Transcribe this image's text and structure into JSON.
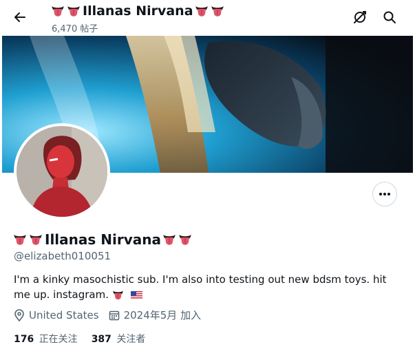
{
  "header": {
    "title": "Illanas Nirvana",
    "post_count": "6,470 帖子"
  },
  "profile": {
    "display_name": "Illanas Nirvana",
    "handle": "@elizabeth010051",
    "bio": "I'm a kinky masochistic sub. I'm also into  testing out new bdsm toys. hit me up. instagram.",
    "location": "United States",
    "joined": "2024年5月 加入",
    "following_count": "176",
    "following_label": "正在关注",
    "followers_count": "387",
    "followers_label": "关注者"
  },
  "icons": {
    "back": "arrow-left-icon",
    "tools": "grok-icon",
    "search": "search-icon",
    "more": "more-horizontal-icon",
    "location": "location-pin-icon",
    "calendar": "calendar-icon",
    "emoji": "tongue-emoji",
    "flag": "us-flag-emoji"
  },
  "colors": {
    "text": "#0f1419",
    "secondary": "#536471",
    "border": "#cfd9de"
  }
}
